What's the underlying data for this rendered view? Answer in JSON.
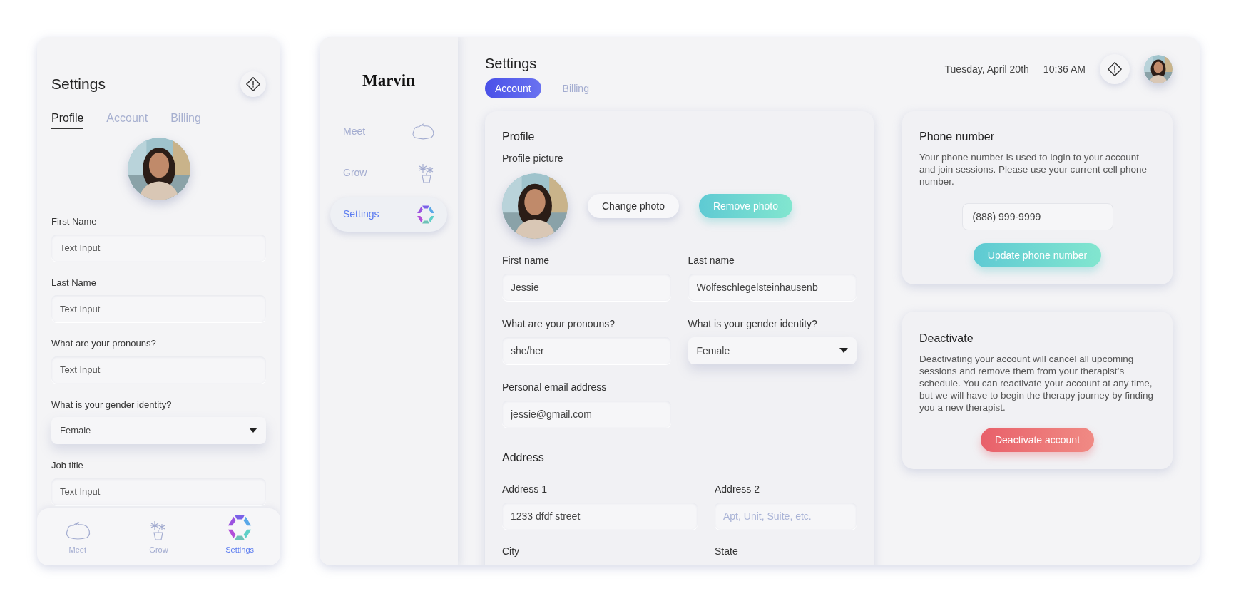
{
  "mobile": {
    "title": "Settings",
    "tabs": [
      {
        "label": "Profile",
        "selected": true
      },
      {
        "label": "Account",
        "selected": false
      },
      {
        "label": "Billing",
        "selected": false
      }
    ],
    "fields": [
      {
        "kind": "text",
        "label": "First Name",
        "placeholder": "Text Input"
      },
      {
        "kind": "text",
        "label": "Last Name",
        "placeholder": "Text Input"
      },
      {
        "kind": "text",
        "label": "What are your pronouns?",
        "placeholder": "Text Input"
      },
      {
        "kind": "select",
        "label": "What is your gender identity?",
        "value": "Female"
      },
      {
        "kind": "text",
        "label": "Job title",
        "placeholder": "Text Input"
      }
    ],
    "nav": [
      {
        "kind": "meet",
        "label": "Meet",
        "selected": false
      },
      {
        "kind": "grow",
        "label": "Grow",
        "selected": false
      },
      {
        "kind": "settings",
        "label": "Settings",
        "selected": true
      }
    ]
  },
  "desktop": {
    "sidebar": {
      "logo": "Marvin",
      "items": [
        {
          "kind": "meet",
          "label": "Meet",
          "selected": false
        },
        {
          "kind": "grow",
          "label": "Grow",
          "selected": false
        },
        {
          "kind": "settings",
          "label": "Settings",
          "selected": true
        }
      ]
    },
    "header": {
      "title": "Settings",
      "tabs": [
        {
          "label": "Account",
          "selected": true
        },
        {
          "label": "Billing",
          "selected": false
        }
      ],
      "date": "Tuesday, April 20th",
      "time": "10:36 AM"
    },
    "profile": {
      "title": "Profile",
      "picture_label": "Profile picture",
      "buttons": [
        {
          "kind": "secondary",
          "label": "Change photo"
        },
        {
          "kind": "accent",
          "label": "Remove photo"
        }
      ],
      "fields": [
        {
          "kind": "text",
          "label": "First name",
          "value": "Jessie"
        },
        {
          "kind": "text",
          "label": "Last name",
          "value": "Wolfeschlegelsteinhausenb"
        },
        {
          "kind": "text",
          "label": "What are your pronouns?",
          "value": "she/her"
        },
        {
          "kind": "select",
          "label": "What is your gender identity?",
          "value": "Female"
        },
        {
          "kind": "text",
          "label": "Personal email address",
          "value": "jessie@gmail.com"
        }
      ]
    },
    "address": {
      "title": "Address",
      "fields": [
        {
          "kind": "text",
          "label": "Address 1",
          "value": "1233 dfdf street"
        },
        {
          "kind": "text",
          "label": "Address 2",
          "placeholder": "Apt, Unit, Suite, etc."
        },
        {
          "kind": "text",
          "label": "City"
        },
        {
          "kind": "text",
          "label": "State"
        }
      ]
    },
    "phone": {
      "title": "Phone number",
      "text": "Your phone number is used to login to your account and join sessions.  Please use your current cell phone number.",
      "value": "(888) 999-9999",
      "button": "Update phone number"
    },
    "deactivate": {
      "title": "Deactivate",
      "text": "Deactivating your account will cancel all upcoming sessions and remove them from your therapist’s schedule.  You can reactivate your account at any time, but we will have to begin the therapy journey by finding you a new therapist.",
      "button": "Deactivate account"
    }
  }
}
